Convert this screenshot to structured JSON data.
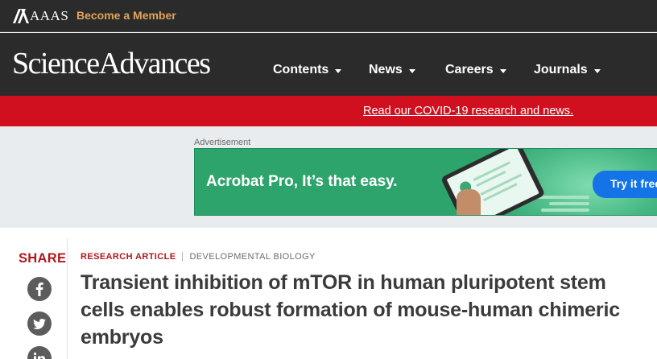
{
  "topbar": {
    "aaas_label": "AAAS",
    "member_link": "Become a Member"
  },
  "nav": {
    "brand": "ScienceAdvances",
    "items": [
      "Contents",
      "News",
      "Careers",
      "Journals"
    ]
  },
  "banner": {
    "link": "Read our COVID-19 research and news."
  },
  "advertisement": {
    "label": "Advertisement",
    "headline": "Acrobat Pro, It’s that easy.",
    "button": "Try it free"
  },
  "article": {
    "share_label": "SHARE",
    "social_icons": [
      "facebook-icon",
      "twitter-icon",
      "linkedin-icon"
    ],
    "type": "RESEARCH ARTICLE",
    "subject": "DEVELOPMENTAL BIOLOGY",
    "title": "Transient inhibition of mTOR in human pluripotent stem cells enables robust formation of mouse-human chimeric embryos"
  },
  "colors": {
    "header_bg": "#2b2b2b",
    "member_accent": "#e0a35c",
    "banner_red": "#d1101f",
    "share_red": "#b0181e",
    "ad_green": "#2ea46d",
    "ad_button_blue": "#1473e6"
  }
}
